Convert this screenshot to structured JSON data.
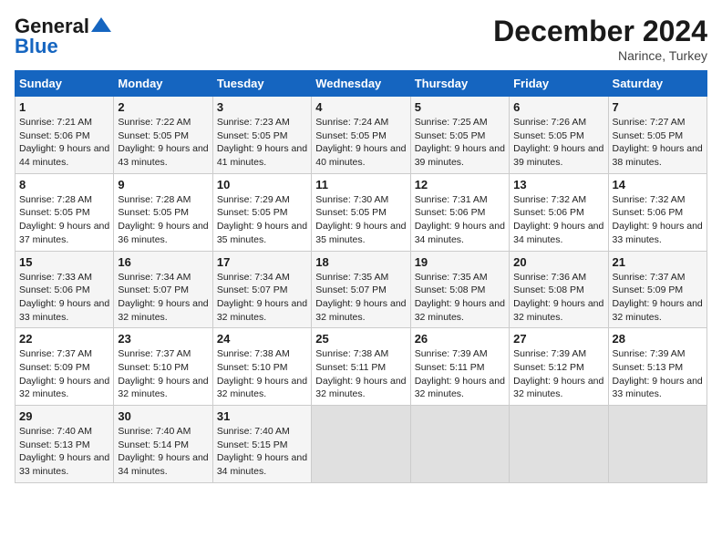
{
  "logo": {
    "line1": "General",
    "line2": "Blue"
  },
  "title": "December 2024",
  "subtitle": "Narince, Turkey",
  "days_header": [
    "Sunday",
    "Monday",
    "Tuesday",
    "Wednesday",
    "Thursday",
    "Friday",
    "Saturday"
  ],
  "weeks": [
    [
      {
        "day": "1",
        "sunrise": "7:21 AM",
        "sunset": "5:06 PM",
        "daylight": "9 hours and 44 minutes."
      },
      {
        "day": "2",
        "sunrise": "7:22 AM",
        "sunset": "5:05 PM",
        "daylight": "9 hours and 43 minutes."
      },
      {
        "day": "3",
        "sunrise": "7:23 AM",
        "sunset": "5:05 PM",
        "daylight": "9 hours and 41 minutes."
      },
      {
        "day": "4",
        "sunrise": "7:24 AM",
        "sunset": "5:05 PM",
        "daylight": "9 hours and 40 minutes."
      },
      {
        "day": "5",
        "sunrise": "7:25 AM",
        "sunset": "5:05 PM",
        "daylight": "9 hours and 39 minutes."
      },
      {
        "day": "6",
        "sunrise": "7:26 AM",
        "sunset": "5:05 PM",
        "daylight": "9 hours and 39 minutes."
      },
      {
        "day": "7",
        "sunrise": "7:27 AM",
        "sunset": "5:05 PM",
        "daylight": "9 hours and 38 minutes."
      }
    ],
    [
      {
        "day": "8",
        "sunrise": "7:28 AM",
        "sunset": "5:05 PM",
        "daylight": "9 hours and 37 minutes."
      },
      {
        "day": "9",
        "sunrise": "7:28 AM",
        "sunset": "5:05 PM",
        "daylight": "9 hours and 36 minutes."
      },
      {
        "day": "10",
        "sunrise": "7:29 AM",
        "sunset": "5:05 PM",
        "daylight": "9 hours and 35 minutes."
      },
      {
        "day": "11",
        "sunrise": "7:30 AM",
        "sunset": "5:05 PM",
        "daylight": "9 hours and 35 minutes."
      },
      {
        "day": "12",
        "sunrise": "7:31 AM",
        "sunset": "5:06 PM",
        "daylight": "9 hours and 34 minutes."
      },
      {
        "day": "13",
        "sunrise": "7:32 AM",
        "sunset": "5:06 PM",
        "daylight": "9 hours and 34 minutes."
      },
      {
        "day": "14",
        "sunrise": "7:32 AM",
        "sunset": "5:06 PM",
        "daylight": "9 hours and 33 minutes."
      }
    ],
    [
      {
        "day": "15",
        "sunrise": "7:33 AM",
        "sunset": "5:06 PM",
        "daylight": "9 hours and 33 minutes."
      },
      {
        "day": "16",
        "sunrise": "7:34 AM",
        "sunset": "5:07 PM",
        "daylight": "9 hours and 32 minutes."
      },
      {
        "day": "17",
        "sunrise": "7:34 AM",
        "sunset": "5:07 PM",
        "daylight": "9 hours and 32 minutes."
      },
      {
        "day": "18",
        "sunrise": "7:35 AM",
        "sunset": "5:07 PM",
        "daylight": "9 hours and 32 minutes."
      },
      {
        "day": "19",
        "sunrise": "7:35 AM",
        "sunset": "5:08 PM",
        "daylight": "9 hours and 32 minutes."
      },
      {
        "day": "20",
        "sunrise": "7:36 AM",
        "sunset": "5:08 PM",
        "daylight": "9 hours and 32 minutes."
      },
      {
        "day": "21",
        "sunrise": "7:37 AM",
        "sunset": "5:09 PM",
        "daylight": "9 hours and 32 minutes."
      }
    ],
    [
      {
        "day": "22",
        "sunrise": "7:37 AM",
        "sunset": "5:09 PM",
        "daylight": "9 hours and 32 minutes."
      },
      {
        "day": "23",
        "sunrise": "7:37 AM",
        "sunset": "5:10 PM",
        "daylight": "9 hours and 32 minutes."
      },
      {
        "day": "24",
        "sunrise": "7:38 AM",
        "sunset": "5:10 PM",
        "daylight": "9 hours and 32 minutes."
      },
      {
        "day": "25",
        "sunrise": "7:38 AM",
        "sunset": "5:11 PM",
        "daylight": "9 hours and 32 minutes."
      },
      {
        "day": "26",
        "sunrise": "7:39 AM",
        "sunset": "5:11 PM",
        "daylight": "9 hours and 32 minutes."
      },
      {
        "day": "27",
        "sunrise": "7:39 AM",
        "sunset": "5:12 PM",
        "daylight": "9 hours and 32 minutes."
      },
      {
        "day": "28",
        "sunrise": "7:39 AM",
        "sunset": "5:13 PM",
        "daylight": "9 hours and 33 minutes."
      }
    ],
    [
      {
        "day": "29",
        "sunrise": "7:40 AM",
        "sunset": "5:13 PM",
        "daylight": "9 hours and 33 minutes."
      },
      {
        "day": "30",
        "sunrise": "7:40 AM",
        "sunset": "5:14 PM",
        "daylight": "9 hours and 34 minutes."
      },
      {
        "day": "31",
        "sunrise": "7:40 AM",
        "sunset": "5:15 PM",
        "daylight": "9 hours and 34 minutes."
      },
      null,
      null,
      null,
      null
    ]
  ],
  "labels": {
    "sunrise": "Sunrise:",
    "sunset": "Sunset:",
    "daylight": "Daylight:"
  }
}
